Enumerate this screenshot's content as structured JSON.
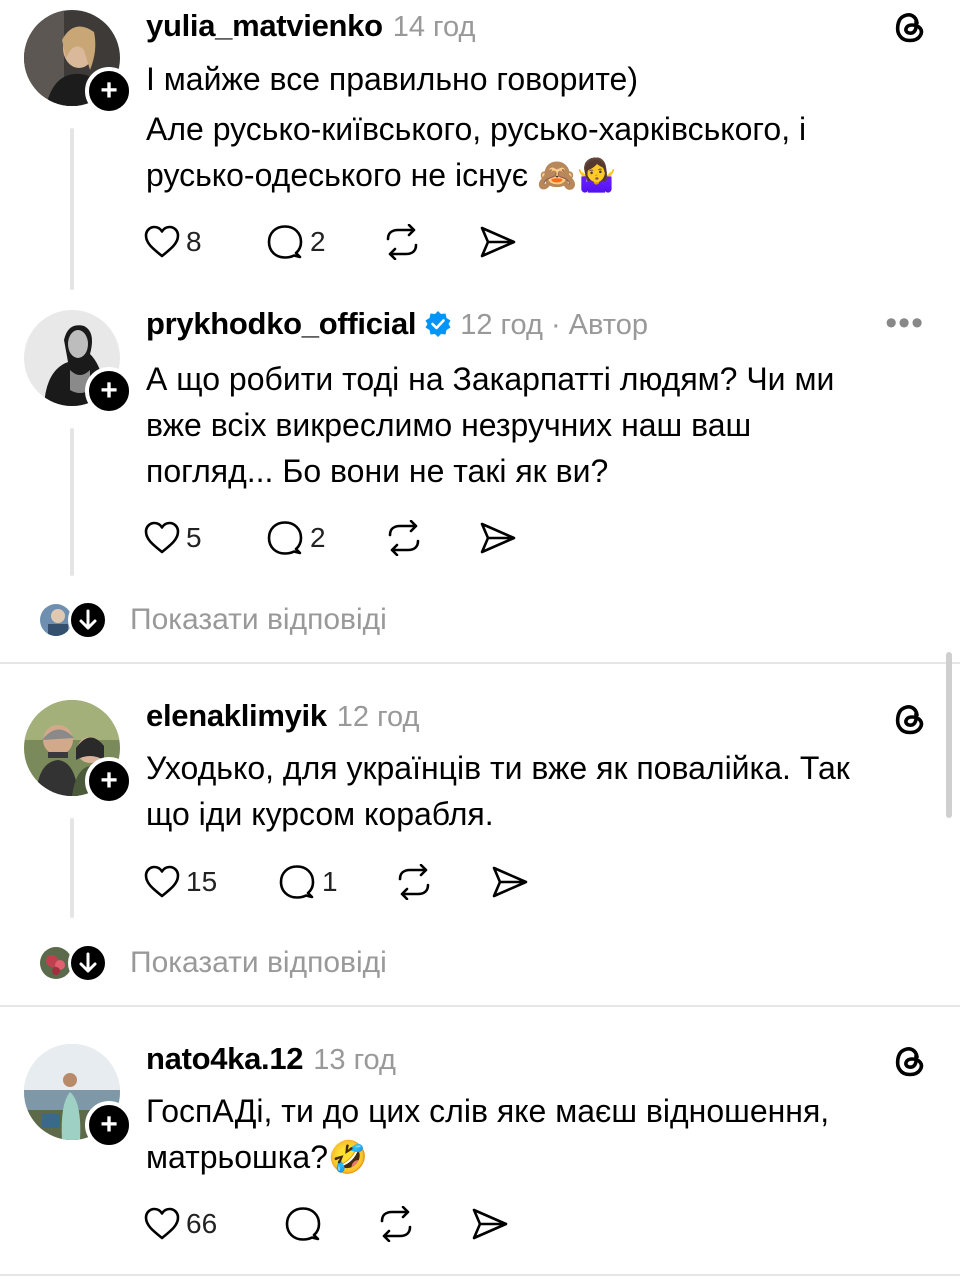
{
  "posts": [
    {
      "username": "yulia_matvienko",
      "time": "14 год",
      "lines": [
        "І майже все правильно говорите)",
        "Але русько-київського, русько-харківського, і",
        "русько-одеського не існує 🙈🤷‍♀️"
      ],
      "likes": "8",
      "replies": "2",
      "corner_icon": "threads-logo-icon"
    },
    {
      "username": "prykhodko_official",
      "time": "12 год · Автор",
      "lines": [
        "А що робити тоді на Закарпатті людям? Чи ми",
        "вже всіх викреслимо незручних наш ваш",
        "погляд... Бо вони не такі як ви?"
      ],
      "likes": "5",
      "replies": "2",
      "corner_icon": "more-icon",
      "more": "•••",
      "show_replies": "Показати відповіді"
    },
    {
      "username": "elenaklimyik",
      "time": "12 год",
      "lines": [
        "Уходько, для українців ти вже як повалійка. Так",
        "що іди курсом корабля."
      ],
      "likes": "15",
      "replies": "1",
      "corner_icon": "threads-logo-icon",
      "show_replies": "Показати відповіді"
    },
    {
      "username": "nato4ka.12",
      "time": "13 год",
      "lines": [
        "ГоспАДі, ти до цих слів яке маєш відношення,",
        "матрьошка?🤣"
      ],
      "likes": "66",
      "replies": "",
      "corner_icon": "threads-logo-icon"
    }
  ],
  "colors": {
    "text": "#000000",
    "secondary": "#999999",
    "verified": "#0095f6",
    "divider": "#e6e6e6"
  }
}
